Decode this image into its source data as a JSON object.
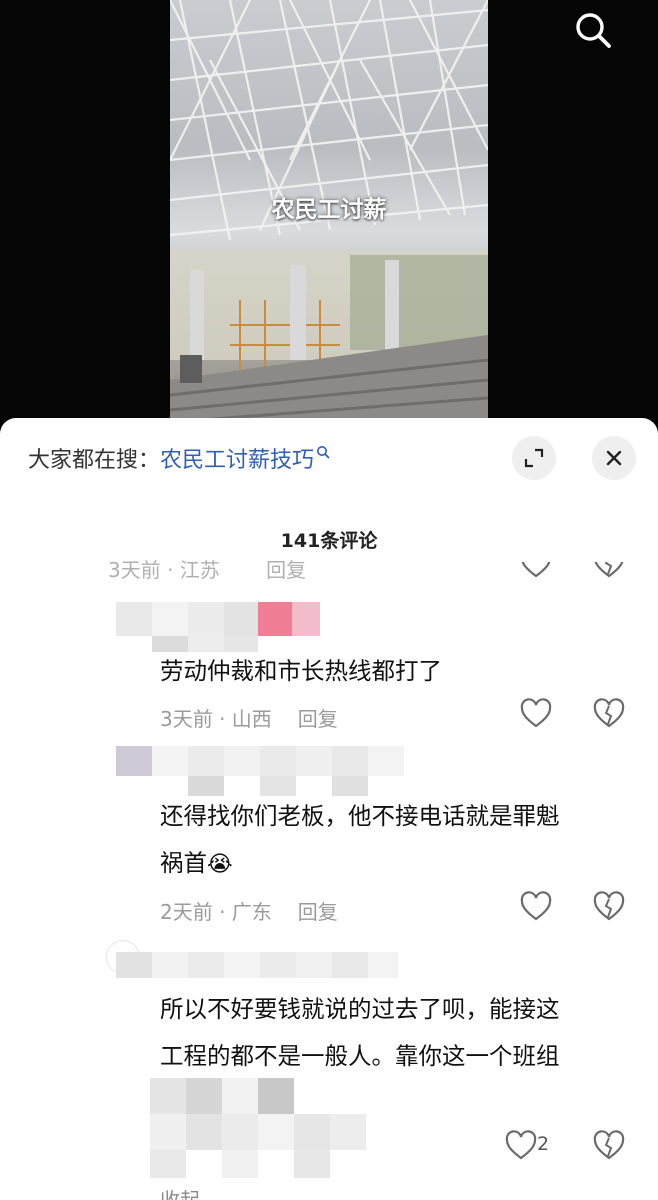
{
  "video": {
    "caption": "农民工讨薪",
    "search_icon": "search-icon"
  },
  "sheet": {
    "trending_prefix": "大家都在搜：",
    "trending_term": "农民工讨薪技巧",
    "expand_icon": "expand-icon",
    "close_icon": "close-icon",
    "comment_count": "141条评论"
  },
  "comments": [
    {
      "meta_time": "3天前 · 江苏",
      "meta_reply": "回复"
    },
    {
      "text": "劳动仲裁和市长热线都打了",
      "time": "3天前 · 山西",
      "reply": "回复"
    },
    {
      "text_line1": "还得找你们老板，他不接电话就是罪魁",
      "text_line2": "祸首",
      "emoji": "😭",
      "time": "2天前 · 广东",
      "reply": "回复"
    },
    {
      "text_line1": "所以不好要钱就说的过去了呗，能接这",
      "text_line2": "工程的都不是一般人。靠你这一个班组",
      "likes": "2"
    }
  ],
  "collapse_label": "收起",
  "colors": {
    "trending_term": "#2f5fb3",
    "meta_gray": "#9a9a9a",
    "sheet_bg": "#ffffff",
    "page_bg": "#000000"
  }
}
